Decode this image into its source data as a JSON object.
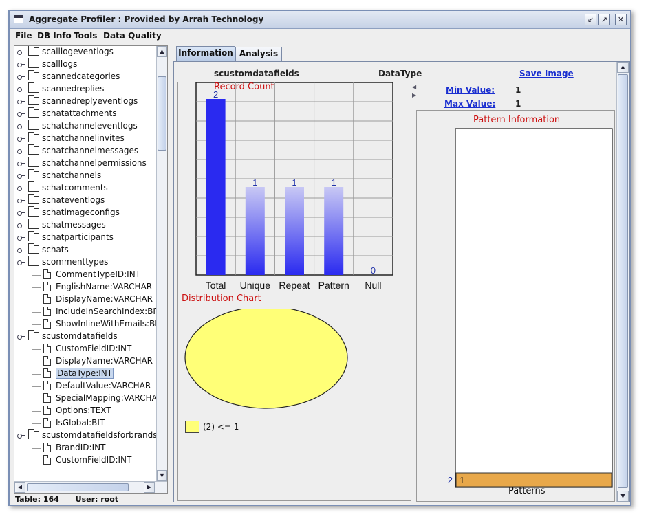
{
  "window": {
    "title": "Aggregate Profiler : Provided by Arrah Technology"
  },
  "menu": [
    {
      "label": "File"
    },
    {
      "label": "DB Info"
    },
    {
      "label": "Tools"
    },
    {
      "label": "Data Quality"
    }
  ],
  "tree": [
    {
      "label": "scalllogeventlogs",
      "type": "folder",
      "level": 0
    },
    {
      "label": "scalllogs",
      "type": "folder",
      "level": 0
    },
    {
      "label": "scannedcategories",
      "type": "folder",
      "level": 0
    },
    {
      "label": "scannedreplies",
      "type": "folder",
      "level": 0
    },
    {
      "label": "scannedreplyeventlogs",
      "type": "folder",
      "level": 0
    },
    {
      "label": "schatattachments",
      "type": "folder",
      "level": 0
    },
    {
      "label": "schatchanneleventlogs",
      "type": "folder",
      "level": 0
    },
    {
      "label": "schatchannelinvites",
      "type": "folder",
      "level": 0
    },
    {
      "label": "schatchannelmessages",
      "type": "folder",
      "level": 0
    },
    {
      "label": "schatchannelpermissions",
      "type": "folder",
      "level": 0
    },
    {
      "label": "schatchannels",
      "type": "folder",
      "level": 0
    },
    {
      "label": "schatcomments",
      "type": "folder",
      "level": 0
    },
    {
      "label": "schateventlogs",
      "type": "folder",
      "level": 0
    },
    {
      "label": "schatimageconfigs",
      "type": "folder",
      "level": 0
    },
    {
      "label": "schatmessages",
      "type": "folder",
      "level": 0
    },
    {
      "label": "schatparticipants",
      "type": "folder",
      "level": 0
    },
    {
      "label": "schats",
      "type": "folder",
      "level": 0
    },
    {
      "label": "scommenttypes",
      "type": "folder",
      "level": 0,
      "expanded": true
    },
    {
      "label": "CommentTypeID:INT",
      "type": "file",
      "level": 1
    },
    {
      "label": "EnglishName:VARCHAR",
      "type": "file",
      "level": 1
    },
    {
      "label": "DisplayName:VARCHAR",
      "type": "file",
      "level": 1
    },
    {
      "label": "IncludeInSearchIndex:BIT",
      "type": "file",
      "level": 1
    },
    {
      "label": "ShowInlineWithEmails:BIT",
      "type": "file",
      "level": 1
    },
    {
      "label": "scustomdatafields",
      "type": "folder",
      "level": 0,
      "expanded": true
    },
    {
      "label": "CustomFieldID:INT",
      "type": "file",
      "level": 1
    },
    {
      "label": "DisplayName:VARCHAR",
      "type": "file",
      "level": 1
    },
    {
      "label": "DataType:INT",
      "type": "file",
      "level": 1,
      "selected": true
    },
    {
      "label": "DefaultValue:VARCHAR",
      "type": "file",
      "level": 1
    },
    {
      "label": "SpecialMapping:VARCHAR",
      "type": "file",
      "level": 1
    },
    {
      "label": "Options:TEXT",
      "type": "file",
      "level": 1
    },
    {
      "label": "IsGlobal:BIT",
      "type": "file",
      "level": 1
    },
    {
      "label": "scustomdatafieldsforbrands",
      "type": "folder",
      "level": 0,
      "expanded": true
    },
    {
      "label": "BrandID:INT",
      "type": "file",
      "level": 1
    },
    {
      "label": "CustomFieldID:INT",
      "type": "file",
      "level": 1
    }
  ],
  "status": {
    "table": "Table: 164",
    "user": "User: root"
  },
  "tabs": [
    {
      "label": "Information"
    },
    {
      "label": "Analysis"
    }
  ],
  "info": {
    "table_name": "scustomdatafields",
    "column_name": "DataType",
    "save_image": "Save Image",
    "min_label": "Min Value:",
    "min_value": "1",
    "max_label": "Max Value:",
    "max_value": "1"
  },
  "chart_data": [
    {
      "type": "bar",
      "title": "Record Count",
      "categories": [
        "Total",
        "Unique",
        "Repeat",
        "Pattern",
        "Null"
      ],
      "values": [
        2,
        1,
        1,
        1,
        0
      ],
      "ylim": [
        0,
        2
      ],
      "grid": true,
      "colors": {
        "strong": "#2a2af0",
        "light": "#c8c8f4"
      }
    },
    {
      "type": "pie",
      "title": "Distribution Chart",
      "slices": [
        {
          "label": "(2) <= 1",
          "value": 2
        }
      ],
      "colors": {
        "fill": "#ffff77"
      }
    },
    {
      "type": "bar",
      "title": "Pattern Information",
      "xlabel": "Patterns",
      "categories": [
        "1"
      ],
      "values": [
        2
      ],
      "orientation": "horizontal",
      "colors": {
        "fill": "#e8a84a"
      }
    }
  ]
}
